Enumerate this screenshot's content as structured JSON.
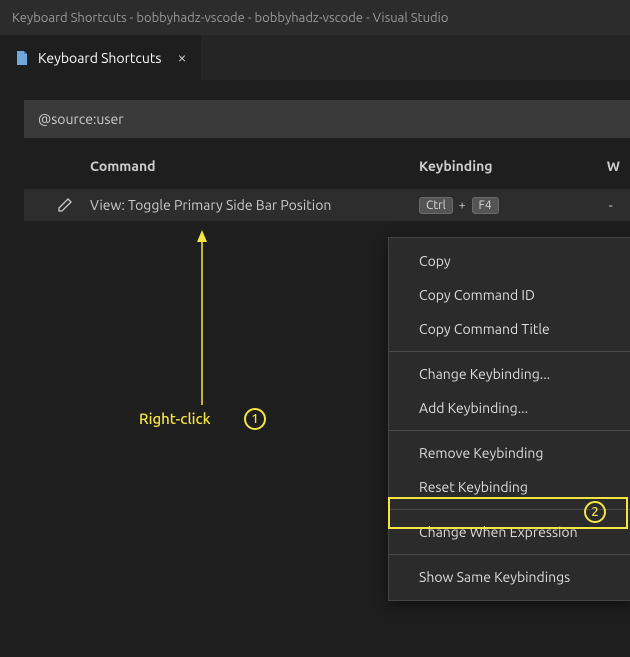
{
  "titleBar": {
    "text": "Keyboard Shortcuts - bobbyhadz-vscode - bobbyhadz-vscode - Visual Studio"
  },
  "tab": {
    "label": "Keyboard Shortcuts"
  },
  "search": {
    "value": "@source:user"
  },
  "tableHeaders": {
    "command": "Command",
    "keybinding": "Keybinding",
    "when": "W"
  },
  "row": {
    "command": "View: Toggle Primary Side Bar Position",
    "key1": "Ctrl",
    "plus": "+",
    "key2": "F4",
    "when": "-"
  },
  "contextMenu": {
    "copy": "Copy",
    "copyCommandId": "Copy Command ID",
    "copyCommandTitle": "Copy Command Title",
    "changeKeybinding": "Change Keybinding...",
    "addKeybinding": "Add Keybinding...",
    "removeKeybinding": "Remove Keybinding",
    "resetKeybinding": "Reset Keybinding",
    "changeWhenExpression": "Change When Expression",
    "showSameKeybindings": "Show Same Keybindings"
  },
  "annotations": {
    "rightClick": "Right-click",
    "num1": "1",
    "num2": "2"
  }
}
